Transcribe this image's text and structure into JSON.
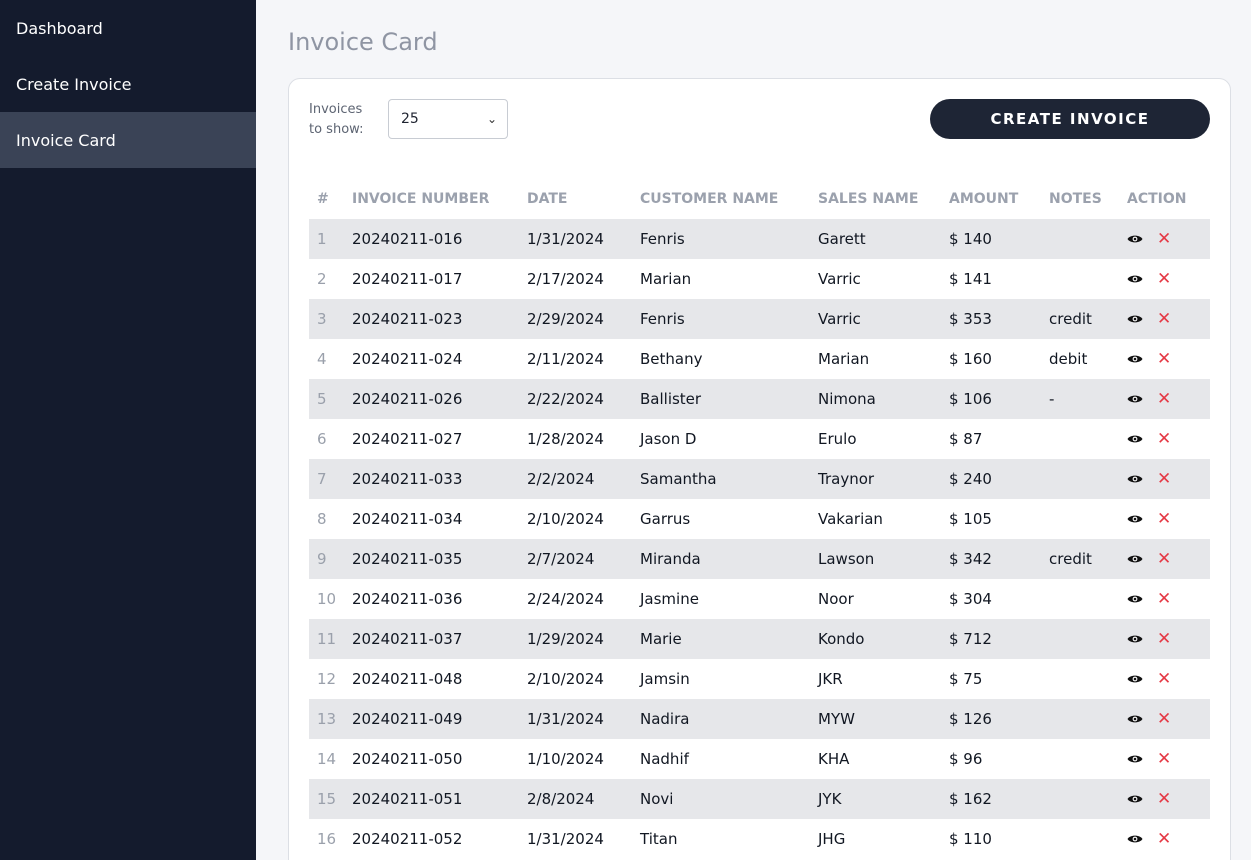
{
  "sidebar": {
    "items": [
      {
        "label": "Dashboard",
        "active": false
      },
      {
        "label": "Create Invoice",
        "active": false
      },
      {
        "label": "Invoice Card",
        "active": true
      }
    ]
  },
  "page": {
    "title": "Invoice Card"
  },
  "controls": {
    "show_label": "Invoices to show:",
    "show_value": "25",
    "create_button": "CREATE INVOICE"
  },
  "table": {
    "headers": [
      "#",
      "INVOICE NUMBER",
      "DATE",
      "CUSTOMER NAME",
      "SALES NAME",
      "AMOUNT",
      "NOTES",
      "ACTION"
    ],
    "rows": [
      {
        "no": "1",
        "invoice": "20240211-016",
        "date": "1/31/2024",
        "customer": "Fenris",
        "sales": "Garett",
        "amount": "$ 140",
        "notes": ""
      },
      {
        "no": "2",
        "invoice": "20240211-017",
        "date": "2/17/2024",
        "customer": "Marian",
        "sales": "Varric",
        "amount": "$ 141",
        "notes": ""
      },
      {
        "no": "3",
        "invoice": "20240211-023",
        "date": "2/29/2024",
        "customer": "Fenris",
        "sales": "Varric",
        "amount": "$ 353",
        "notes": "credit"
      },
      {
        "no": "4",
        "invoice": "20240211-024",
        "date": "2/11/2024",
        "customer": "Bethany",
        "sales": "Marian",
        "amount": "$ 160",
        "notes": "debit"
      },
      {
        "no": "5",
        "invoice": "20240211-026",
        "date": "2/22/2024",
        "customer": "Ballister",
        "sales": "Nimona",
        "amount": "$ 106",
        "notes": "-"
      },
      {
        "no": "6",
        "invoice": "20240211-027",
        "date": "1/28/2024",
        "customer": "Jason D",
        "sales": "Erulo",
        "amount": "$ 87",
        "notes": ""
      },
      {
        "no": "7",
        "invoice": "20240211-033",
        "date": "2/2/2024",
        "customer": "Samantha",
        "sales": "Traynor",
        "amount": "$ 240",
        "notes": ""
      },
      {
        "no": "8",
        "invoice": "20240211-034",
        "date": "2/10/2024",
        "customer": "Garrus",
        "sales": "Vakarian",
        "amount": "$ 105",
        "notes": ""
      },
      {
        "no": "9",
        "invoice": "20240211-035",
        "date": "2/7/2024",
        "customer": "Miranda",
        "sales": "Lawson",
        "amount": "$ 342",
        "notes": "credit"
      },
      {
        "no": "10",
        "invoice": "20240211-036",
        "date": "2/24/2024",
        "customer": "Jasmine",
        "sales": "Noor",
        "amount": "$ 304",
        "notes": ""
      },
      {
        "no": "11",
        "invoice": "20240211-037",
        "date": "1/29/2024",
        "customer": "Marie",
        "sales": "Kondo",
        "amount": "$ 712",
        "notes": ""
      },
      {
        "no": "12",
        "invoice": "20240211-048",
        "date": "2/10/2024",
        "customer": "Jamsin",
        "sales": "JKR",
        "amount": "$ 75",
        "notes": ""
      },
      {
        "no": "13",
        "invoice": "20240211-049",
        "date": "1/31/2024",
        "customer": "Nadira",
        "sales": "MYW",
        "amount": "$ 126",
        "notes": ""
      },
      {
        "no": "14",
        "invoice": "20240211-050",
        "date": "1/10/2024",
        "customer": "Nadhif",
        "sales": "KHA",
        "amount": "$ 96",
        "notes": ""
      },
      {
        "no": "15",
        "invoice": "20240211-051",
        "date": "2/8/2024",
        "customer": "Novi",
        "sales": "JYK",
        "amount": "$ 162",
        "notes": ""
      },
      {
        "no": "16",
        "invoice": "20240211-052",
        "date": "1/31/2024",
        "customer": "Titan",
        "sales": "JHG",
        "amount": "$ 110",
        "notes": ""
      }
    ],
    "action_icons": [
      "eye-icon",
      "close-icon"
    ]
  },
  "colors": {
    "sidebar_bg": "#141b2d",
    "active_item_bg": "#3a4356",
    "button_bg": "#1e2535",
    "delete_red": "#e53945",
    "stripe": "#e6e7ea"
  }
}
